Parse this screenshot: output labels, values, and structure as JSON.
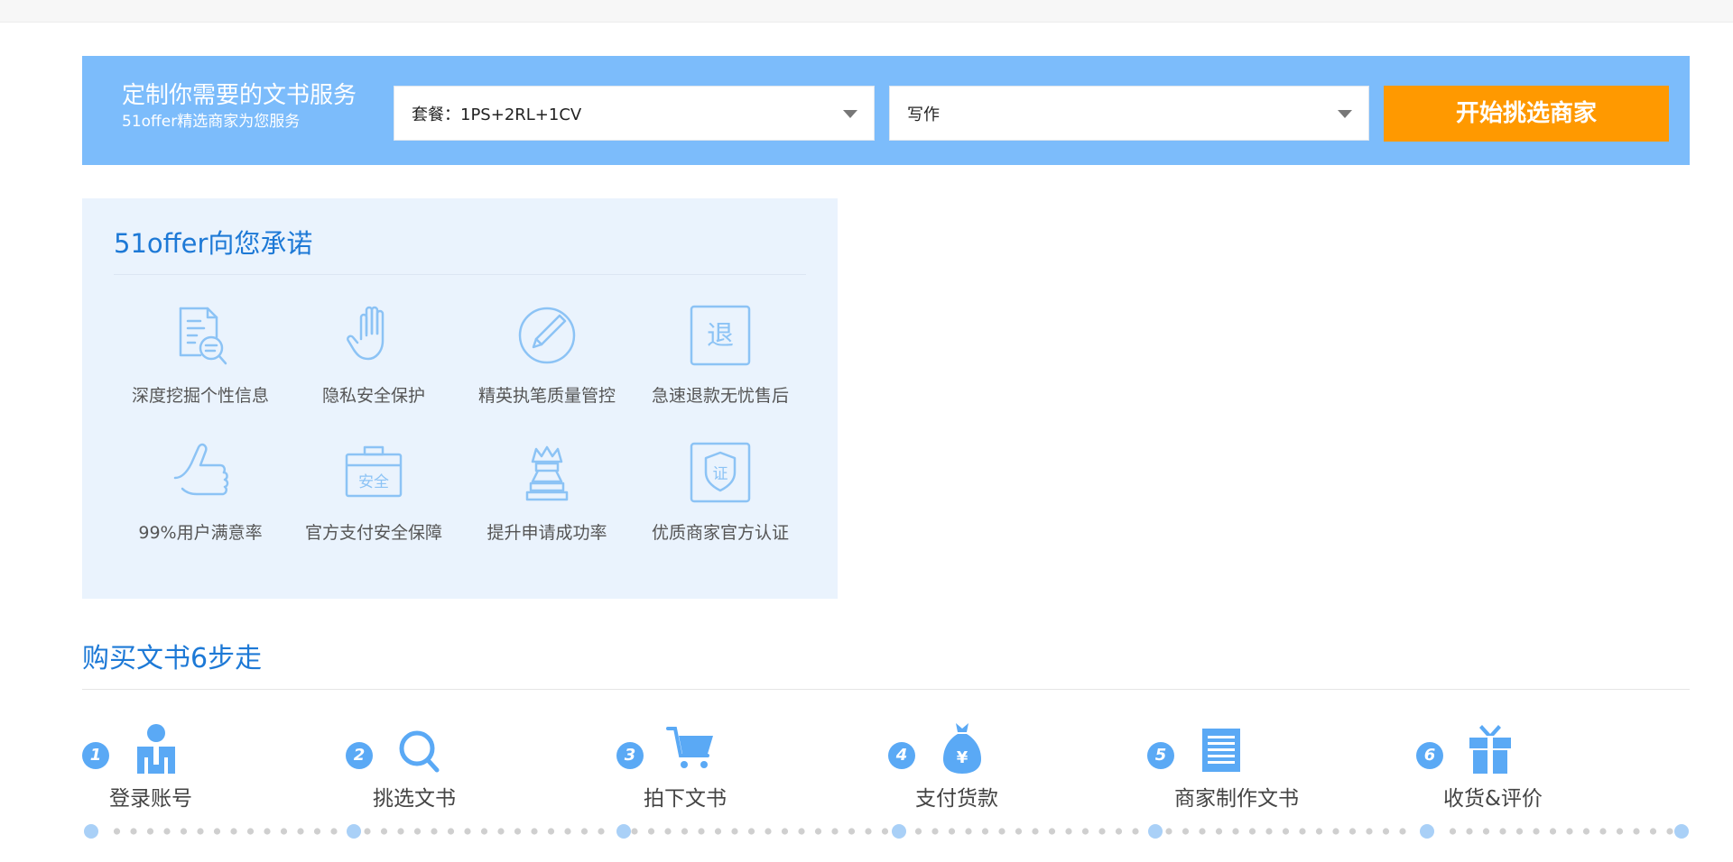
{
  "colors": {
    "banner_bg": "#7cbcfb",
    "button_bg": "#ff9900",
    "title_blue": "#1d79d6",
    "panel_bg": "#eaf3fd",
    "icon_blue": "#8cc3f5",
    "step_blue": "#5aa9f5"
  },
  "banner": {
    "title": "定制你需要的文书服务",
    "subtitle": "51offer精选商家为您服务",
    "package_select": {
      "value": "套餐：1PS+2RL+1CV",
      "icon": "caret-down-icon"
    },
    "service_select": {
      "value": "写作",
      "icon": "caret-down-icon"
    },
    "start_button": "开始挑选商家"
  },
  "promise": {
    "title": "51offer向您承诺",
    "items": [
      {
        "label": "深度挖掘个性信息",
        "icon": "document-search-icon"
      },
      {
        "label": "隐私安全保护",
        "icon": "hand-icon"
      },
      {
        "label": "精英执笔质量管控",
        "icon": "pen-circle-icon"
      },
      {
        "label": "急速退款无忧售后",
        "icon": "refund-icon",
        "icon_text": "退"
      },
      {
        "label": "99%用户满意率",
        "icon": "thumbs-up-icon"
      },
      {
        "label": "官方支付安全保障",
        "icon": "safe-box-icon",
        "icon_text": "安全"
      },
      {
        "label": "提升申请成功率",
        "icon": "crown-icon"
      },
      {
        "label": "优质商家官方认证",
        "icon": "certified-shield-icon",
        "icon_text": "证"
      }
    ]
  },
  "steps": {
    "title": "购买文书6步走",
    "items": [
      {
        "num": "1",
        "label": "登录账号",
        "icon": "user-icon"
      },
      {
        "num": "2",
        "label": "挑选文书",
        "icon": "magnifier-icon"
      },
      {
        "num": "3",
        "label": "拍下文书",
        "icon": "cart-icon"
      },
      {
        "num": "4",
        "label": "支付货款",
        "icon": "money-bag-icon",
        "icon_text": "¥"
      },
      {
        "num": "5",
        "label": "商家制作文书",
        "icon": "document-icon"
      },
      {
        "num": "6",
        "label": "收货&评价",
        "icon": "gift-icon"
      }
    ]
  }
}
